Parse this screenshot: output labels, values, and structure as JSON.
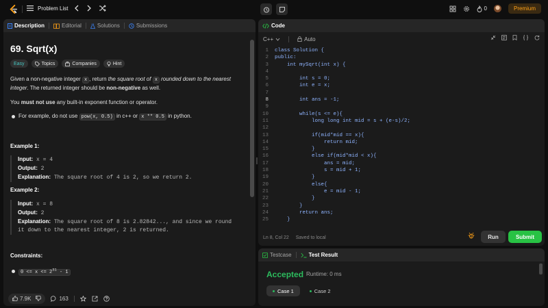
{
  "topbar": {
    "problem_list_label": "Problem List",
    "streak_count": "0",
    "premium_label": "Premium"
  },
  "left_tabs": [
    {
      "label": "Description"
    },
    {
      "label": "Editorial"
    },
    {
      "label": "Solutions"
    },
    {
      "label": "Submissions"
    }
  ],
  "problem": {
    "title": "69. Sqrt(x)",
    "difficulty": "Easy",
    "chips": [
      "Topics",
      "Companies",
      "Hint"
    ],
    "para1_a": "Given a non-negative integer ",
    "para1_code": "x",
    "para1_b": ", return ",
    "para1_c": "the square root of ",
    "para1_code2": "x",
    "para1_d": " rounded down to the nearest integer",
    "para1_e": ". The returned integer should be ",
    "para1_f": "non-negative",
    "para1_g": " as well.",
    "para2_a": "You ",
    "para2_b": "must not use",
    "para2_c": " any built-in exponent function or operator.",
    "bullet_a": "For example, do not use ",
    "bullet_code1": "pow(x, 0.5)",
    "bullet_b": " in c++ or ",
    "bullet_code2": "x ** 0.5",
    "bullet_c": " in python.",
    "example1_title": "Example 1:",
    "example1": {
      "input_label": "Input:",
      "input": " x = 4",
      "output_label": "Output:",
      "output": " 2",
      "explanation_label": "Explanation:",
      "explanation": " The square root of 4 is 2, so we return 2."
    },
    "example2_title": "Example 2:",
    "example2": {
      "input_label": "Input:",
      "input": " x = 8",
      "output_label": "Output:",
      "output": " 2",
      "explanation_label": "Explanation:",
      "explanation_line1": " The square root of 8 is 2.82842..., and since we round",
      "explanation_line2": "it down to the nearest integer, 2 is returned."
    },
    "constraints_title": "Constraints:",
    "constraint_base": "0 <= x <= 2",
    "constraint_sup": "31",
    "constraint_tail": " - 1"
  },
  "left_footer": {
    "likes": "7.9K",
    "comments": "163"
  },
  "code_panel": {
    "title": "Code",
    "language": "C++",
    "auto_label": "Auto",
    "status_pos": "Ln 8, Col 22",
    "status_saved": "Saved to local",
    "run_label": "Run",
    "submit_label": "Submit",
    "lines": [
      {
        "n": "1",
        "code": "class Solution {"
      },
      {
        "n": "2",
        "code": "public:"
      },
      {
        "n": "3",
        "code": "    int mySqrt(int x) {"
      },
      {
        "n": "4",
        "code": ""
      },
      {
        "n": "5",
        "code": "        int s = 0;"
      },
      {
        "n": "6",
        "code": "        int e = x;"
      },
      {
        "n": "7",
        "code": ""
      },
      {
        "n": "8",
        "code": "        int ans = -1;"
      },
      {
        "n": "9",
        "code": ""
      },
      {
        "n": "10",
        "code": "        while(s <= e){"
      },
      {
        "n": "11",
        "code": "            long long int mid = s + (e-s)/2;"
      },
      {
        "n": "12",
        "code": ""
      },
      {
        "n": "13",
        "code": "            if(mid*mid == x){"
      },
      {
        "n": "14",
        "code": "                return mid;"
      },
      {
        "n": "15",
        "code": "            }"
      },
      {
        "n": "16",
        "code": "            else if(mid*mid < x){"
      },
      {
        "n": "17",
        "code": "                ans = mid;"
      },
      {
        "n": "18",
        "code": "                s = mid + 1;"
      },
      {
        "n": "19",
        "code": "            }"
      },
      {
        "n": "20",
        "code": "            else{"
      },
      {
        "n": "21",
        "code": "                e = mid - 1;"
      },
      {
        "n": "22",
        "code": "            }"
      },
      {
        "n": "23",
        "code": "        }"
      },
      {
        "n": "24",
        "code": "        return ans;"
      },
      {
        "n": "25",
        "code": "    }"
      }
    ]
  },
  "test_panel": {
    "testcase_tab": "Testcase",
    "result_tab": "Test Result",
    "verdict": "Accepted",
    "runtime": "Runtime: 0 ms",
    "cases": [
      "Case 1",
      "Case 2"
    ]
  },
  "colors": {
    "accent_orange": "#ffa116",
    "accepted_green": "#2cbb5d",
    "submit_green": "#28c244",
    "code_blue": "#8fb4ff"
  }
}
